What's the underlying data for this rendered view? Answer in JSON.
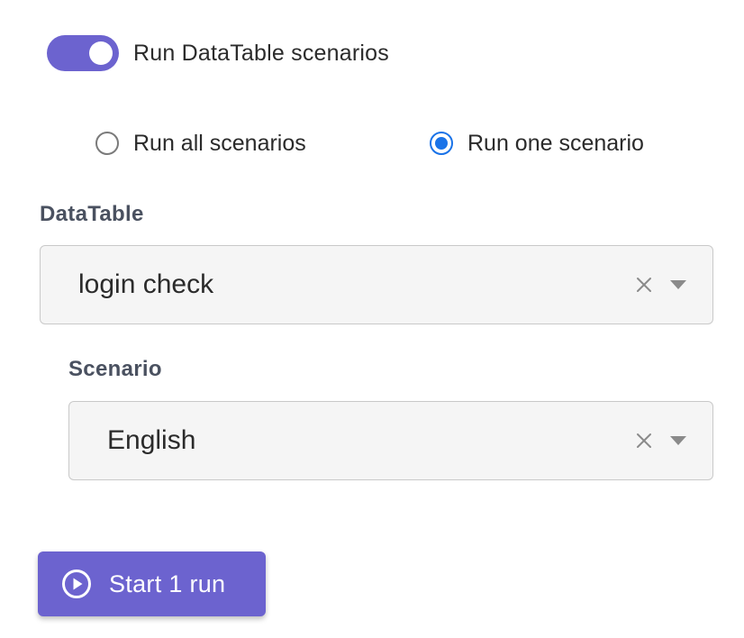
{
  "toggle": {
    "label": "Run DataTable scenarios",
    "on": true,
    "color": "#6c63cf"
  },
  "radios": [
    {
      "label": "Run all scenarios",
      "checked": false
    },
    {
      "label": "Run one scenario",
      "checked": true
    }
  ],
  "datatable": {
    "label": "DataTable",
    "value": "login check",
    "clear_icon": "close-icon",
    "dropdown_icon": "chevron-down-icon"
  },
  "scenario": {
    "label": "Scenario",
    "value": "English",
    "clear_icon": "close-icon",
    "dropdown_icon": "chevron-down-icon"
  },
  "start_button": {
    "label": "Start 1 run",
    "icon": "play-circle-icon",
    "color": "#6c63cf"
  },
  "colors": {
    "accent": "#6c63cf",
    "radio_selected": "#1a73e8",
    "label_text": "#4a5160"
  }
}
